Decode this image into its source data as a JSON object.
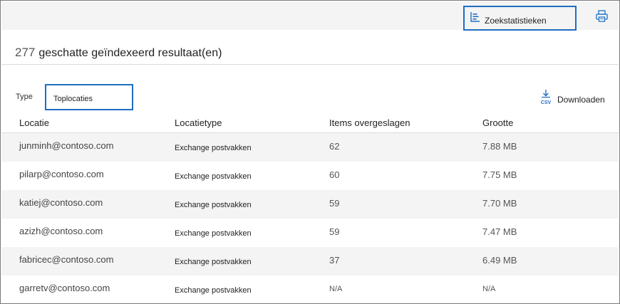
{
  "toolbar": {
    "stats_label": "Zoekstatistieken"
  },
  "summary": {
    "count": "277",
    "text": "geschatte geïndexeerd resultaat(en)"
  },
  "filter": {
    "type_label": "Type",
    "type_value": "Toplocaties",
    "download_label": "Downloaden",
    "download_icon_text": "CSV"
  },
  "table": {
    "headers": [
      "Locatie",
      "Locatietype",
      "Items overgeslagen",
      "Grootte"
    ],
    "rows": [
      {
        "location": "junminh@contoso.com",
        "type": "Exchange postvakken",
        "items": "62",
        "size": "7.88 MB"
      },
      {
        "location": "pilarp@contoso.com",
        "type": "Exchange postvakken",
        "items": "60",
        "size": "7.75 MB"
      },
      {
        "location": "katiej@contoso.com",
        "type": "Exchange postvakken",
        "items": "59",
        "size": "7.70 MB"
      },
      {
        "location": "azizh@contoso.com",
        "type": "Exchange postvakken",
        "items": "59",
        "size": "7.47 MB"
      },
      {
        "location": "fabricec@contoso.com",
        "type": "Exchange postvakken",
        "items": "37",
        "size": "6.49 MB"
      },
      {
        "location": "garretv@contoso.com",
        "type": "Exchange postvakken",
        "items": "N/A",
        "size": "N/A"
      }
    ]
  },
  "colors": {
    "highlight_border": "#1e6ec2",
    "toolbar_bg": "#f4f4f4",
    "icon_blue": "#1e6ec2"
  },
  "icons": {
    "stats": "chart-lines-icon",
    "print": "printer-icon",
    "download": "csv-download-icon"
  }
}
